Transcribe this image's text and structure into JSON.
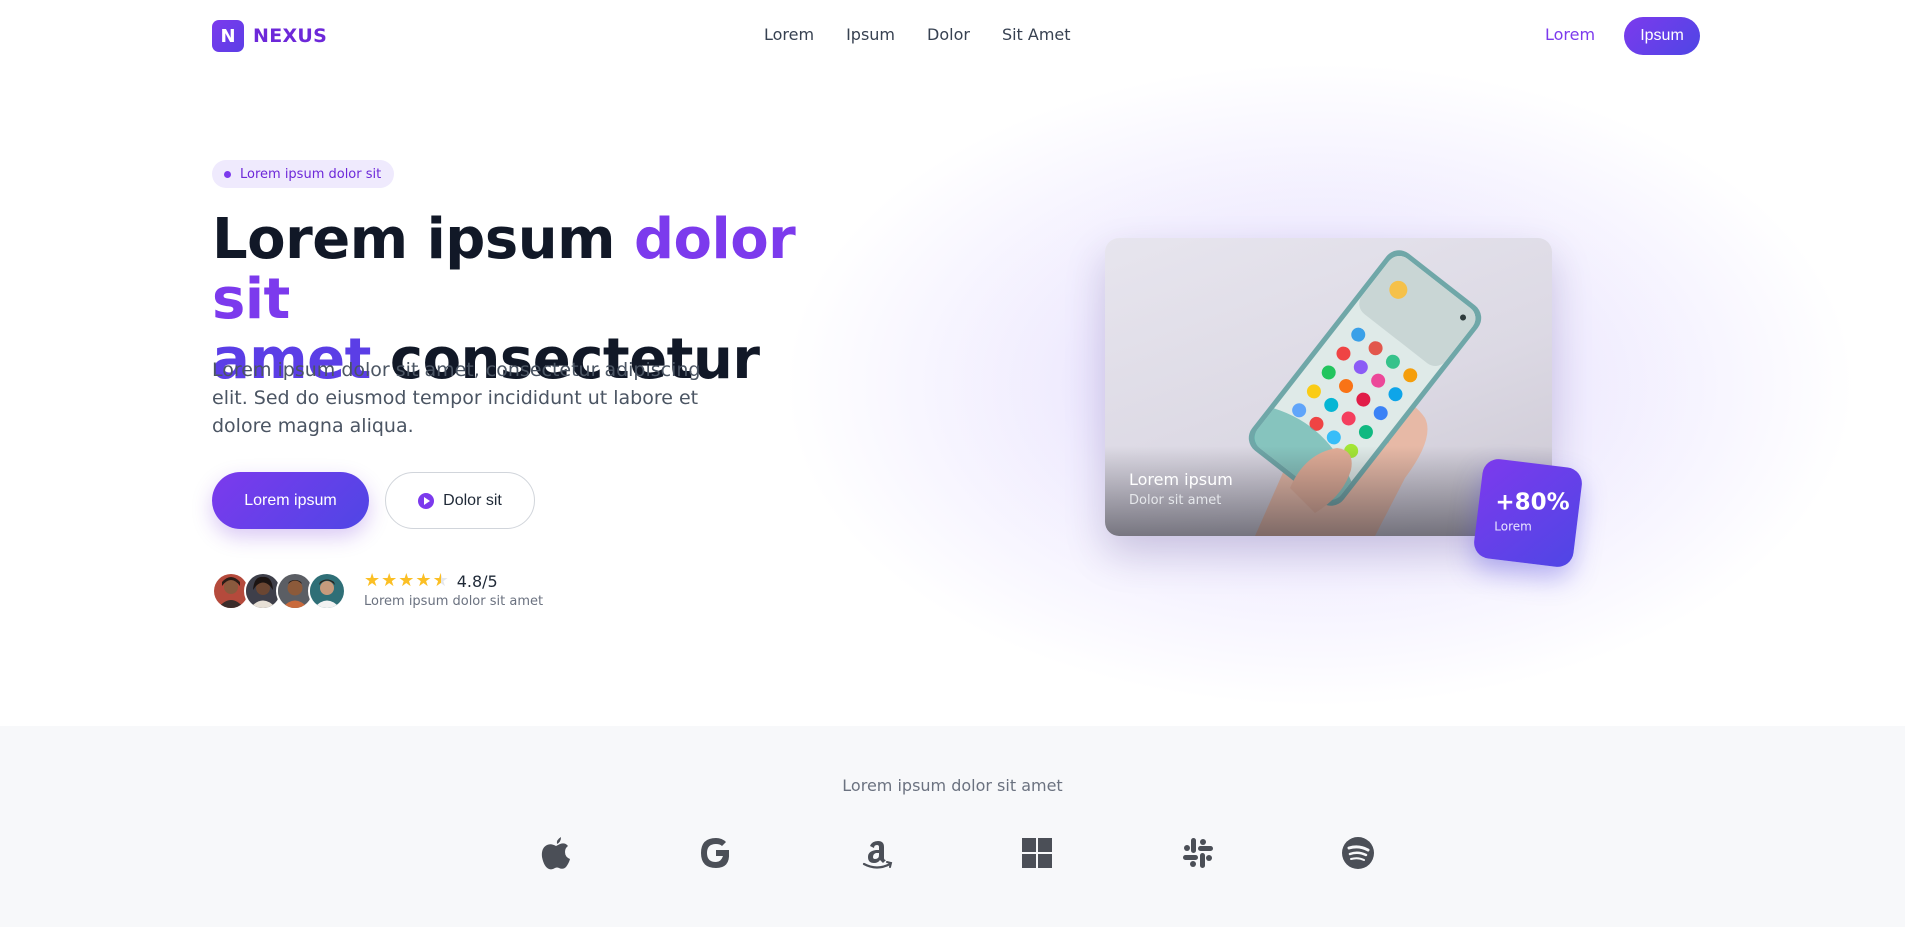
{
  "nav": {
    "logo_letter": "N",
    "brand": "NEXUS",
    "links": [
      "Lorem",
      "Ipsum",
      "Dolor",
      "Sit Amet"
    ],
    "login": "Lorem",
    "cta": "Ipsum"
  },
  "hero": {
    "badge": "Lorem ipsum dolor sit",
    "headline": {
      "part1": "Lorem ipsum ",
      "accent1": "dolor sit",
      "accent2": "amet",
      "part2": " consectetur"
    },
    "lead": "Lorem ipsum dolor sit amet, consectetur adipiscing elit. Sed do eiusmod tempor incididunt ut labore et dolore magna aliqua.",
    "primary_button": "Lorem ipsum",
    "secondary_button": "Dolor sit",
    "rating_value": "4.8/5",
    "rating_caption": "Lorem ipsum dolor sit amet",
    "rating_stars": 4.5
  },
  "card": {
    "title": "Lorem ipsum",
    "subtitle": "Dolor sit amet"
  },
  "stat": {
    "value": "+80%",
    "label": "Lorem"
  },
  "logos": {
    "caption": "Lorem ipsum dolor sit amet",
    "icons": [
      "apple-icon",
      "google-icon",
      "amazon-icon",
      "windows-icon",
      "slack-icon",
      "spotify-icon"
    ]
  },
  "colors": {
    "accent": "#7c3aed",
    "accent_dark": "#4f46e5",
    "text": "#111827",
    "muted": "#6b7280",
    "star": "#fbbf24",
    "strip_bg": "#f7f8fa"
  }
}
